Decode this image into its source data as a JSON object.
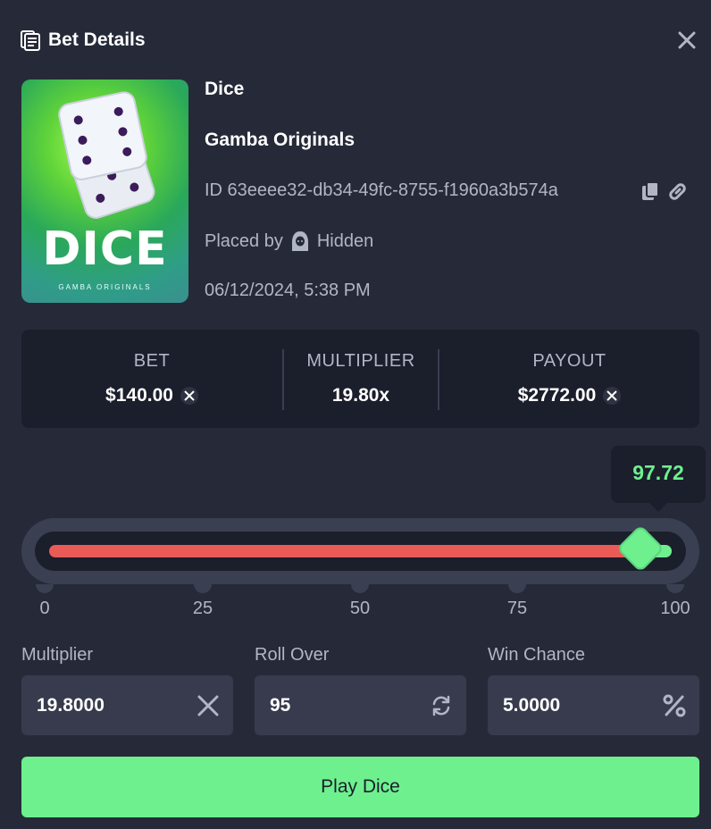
{
  "header": {
    "title": "Bet Details",
    "icon": "document-icon",
    "close_icon": "close-icon"
  },
  "game": {
    "name": "Dice",
    "provider": "Gamba Originals",
    "id_label": "ID 63eeee32-db34-49fc-8755-f1960a3b574a",
    "placed_by_label": "Placed by",
    "placed_by_user": "Hidden",
    "date": "06/12/2024, 5:38 PM",
    "thumbnail": {
      "title": "DICE",
      "subtitle": "GAMBA ORIGINALS"
    }
  },
  "stats": {
    "bet_label": "BET",
    "bet_value": "$140.00",
    "multiplier_label": "MULTIPLIER",
    "multiplier_value": "19.80x",
    "payout_label": "PAYOUT",
    "payout_value": "$2772.00"
  },
  "slider": {
    "result": "97.72",
    "result_value": 97.72,
    "ticks": [
      "0",
      "25",
      "50",
      "75",
      "100"
    ],
    "lose_color": "#ea5a57",
    "win_color": "#6ef08f"
  },
  "fields": {
    "multiplier_label": "Multiplier",
    "multiplier_value": "19.8000",
    "roll_over_label": "Roll Over",
    "roll_over_value": "95",
    "win_chance_label": "Win Chance",
    "win_chance_value": "5.0000"
  },
  "play_button": "Play Dice",
  "colors": {
    "background": "#262a38",
    "panel": "#1b1e2b",
    "accent": "#6ef08f"
  }
}
